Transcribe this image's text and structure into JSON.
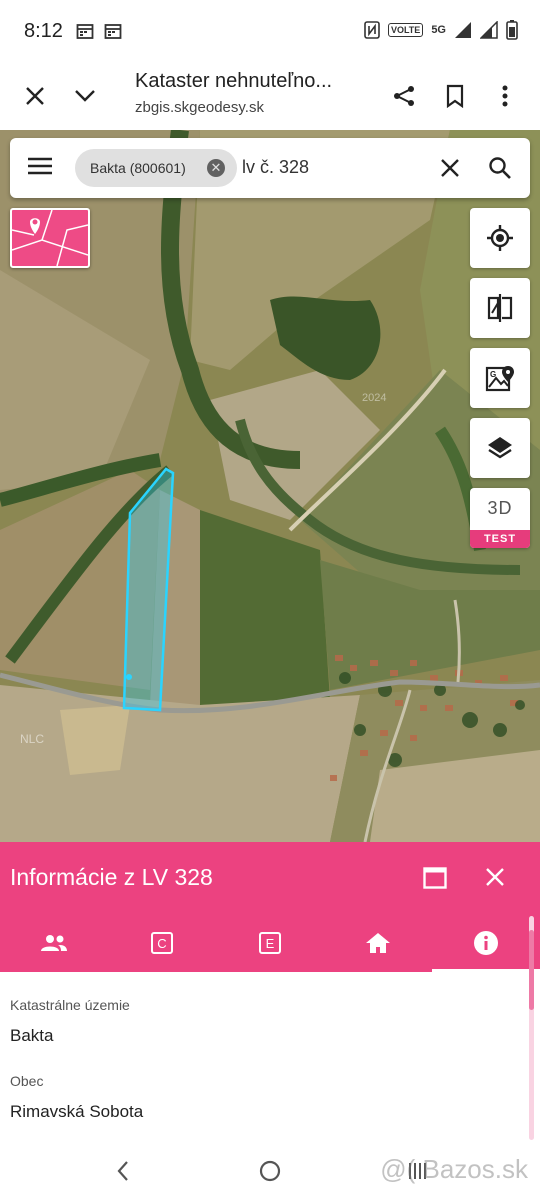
{
  "status": {
    "time": "8:12",
    "volte": "VOLTE",
    "network": "5G"
  },
  "browser": {
    "title": "Kataster nehnuteľno...",
    "url": "zbgis.skgeodesy.sk",
    "icons": [
      "close-icon",
      "chevron-down-icon",
      "share-icon",
      "bookmark-icon",
      "more-vert-icon"
    ]
  },
  "search": {
    "chip_label": "Bakta (800601)",
    "query": "lv č. 328"
  },
  "map": {
    "watermark": "NLC",
    "year": "2024",
    "tools": [
      "my-location-icon",
      "compare-icon",
      "map-search-icon",
      "layers-icon"
    ],
    "btn_3d": "3D",
    "btn_3d_badge": "TEST"
  },
  "panel": {
    "title": "Informácie z LV 328",
    "tabs": [
      "owners-icon",
      "c-register-icon",
      "e-register-icon",
      "building-icon",
      "info-icon"
    ],
    "active_tab": 4,
    "fields": [
      {
        "label": "Katastrálne územie",
        "value": "Bakta"
      },
      {
        "label": "Obec",
        "value": "Rimavská Sobota"
      }
    ]
  },
  "watermark_bazos": "@( Bazos.sk",
  "colors": {
    "accent": "#ec4280",
    "parcel": "#2ad4ff"
  }
}
